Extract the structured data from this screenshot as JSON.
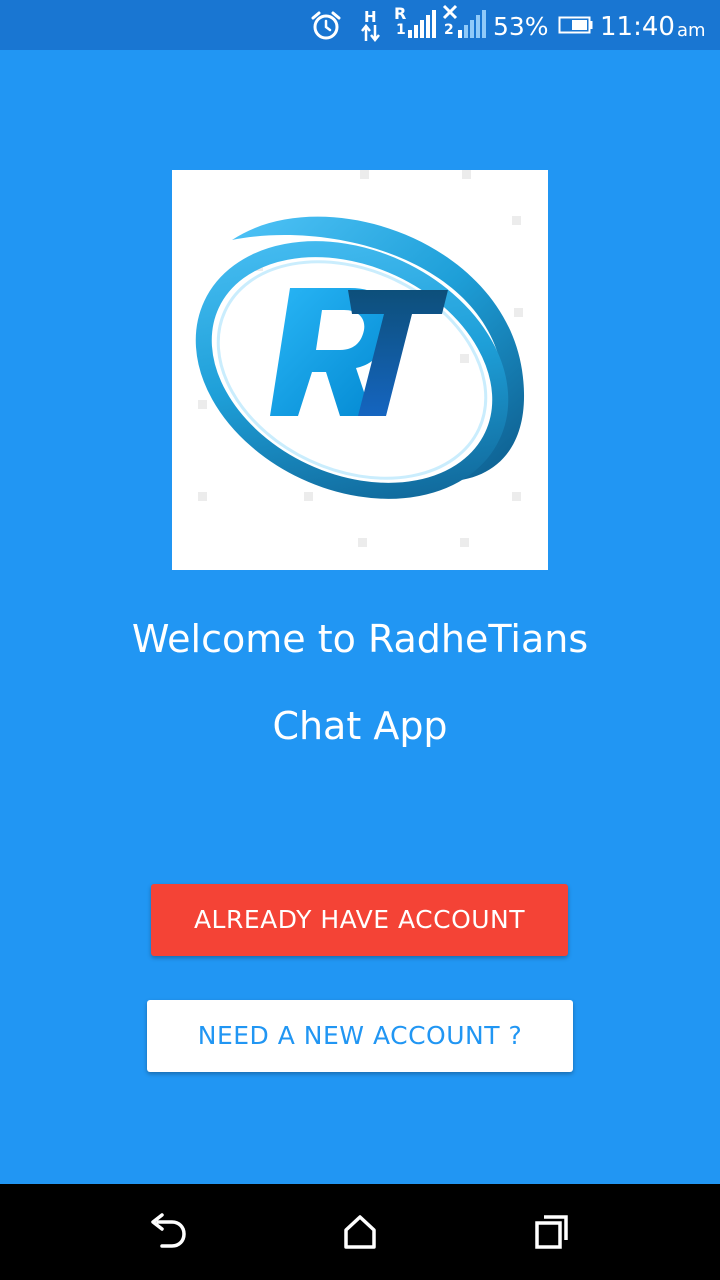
{
  "status_bar": {
    "network_h": "H",
    "network_r": "R",
    "sim1": "1",
    "sim2": "2",
    "battery": "53%",
    "time": "11:40",
    "ampm": "am"
  },
  "welcome": {
    "line1": "Welcome to RadheTians",
    "line2": "Chat App"
  },
  "buttons": {
    "login": "ALREADY HAVE ACCOUNT",
    "register": "NEED A NEW ACCOUNT ?"
  },
  "logo": {
    "text": "RT"
  },
  "colors": {
    "background": "#2196F3",
    "status_bar": "#1976D2",
    "login_button": "#F44336",
    "register_text": "#2196F3"
  },
  "icons": {
    "alarm": "alarm-icon",
    "signal": "signal-icon",
    "battery": "battery-icon",
    "back": "back-icon",
    "home": "home-icon",
    "recents": "recents-icon"
  }
}
